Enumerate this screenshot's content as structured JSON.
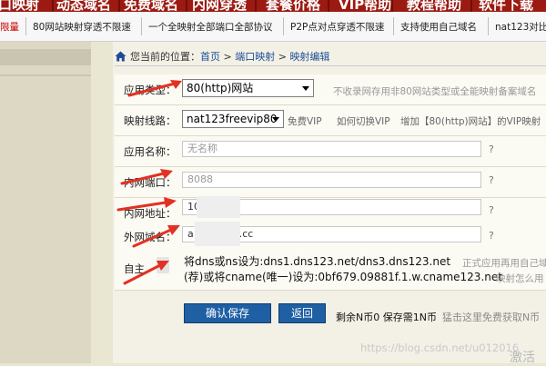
{
  "top_nav": {
    "items": [
      "口映射",
      "动态域名",
      "免费域名",
      "内网穿透",
      "套餐价格",
      "VIP帮助",
      "教程帮助",
      "软件下载"
    ]
  },
  "ticker": {
    "items": [
      "限量",
      "80网站映射穿透不限速",
      "一个全映射全部端口全部协议",
      "P2P点对点穿透不限速",
      "支持使用自己域名",
      "nat123对比"
    ]
  },
  "breadcrumb": {
    "prefix": "您当前的位置：",
    "home": "首页",
    "sep": ">",
    "section": "端口映射",
    "page": "映射编辑"
  },
  "form": {
    "app_type": {
      "label": "应用类型：",
      "value": "80(http)网站",
      "note": "不收录网存用非80网站类型或全能映射备案域名"
    },
    "line": {
      "label": "映射线路：",
      "value": "nat123freevip80",
      "vip": "免费VIP",
      "howto": "如何切换VIP",
      "add": "增加【80(http)网站】的VIP映射"
    },
    "app_name": {
      "label": "应用名称：",
      "placeholder": "无名称",
      "q": "?"
    },
    "inner_port": {
      "label": "内网端口：",
      "value": "8088",
      "q": "?"
    },
    "inner_addr": {
      "label": "内网地址：",
      "value": "10",
      "q": "?"
    },
    "outer_domain": {
      "label": "外网域名：",
      "value_pre": "a",
      "value_post": ".cc",
      "q": "?"
    },
    "custom": {
      "label": "自主",
      "dns_line": "将dns或ns设为:dns1.dns123.net/dns3.dns123.net",
      "cname_line": "(荐)或将cname(唯一)设为:0bf679.09881f.1.w.cname123.net",
      "right1": "正式应用再用自己域",
      "right2": "映射怎么用"
    }
  },
  "buttons": {
    "save": "确认保存",
    "back": "返回"
  },
  "balance": {
    "text": "剩余N币0 保存需1N币",
    "hint": "猛击这里免费获取N币",
    "q": "?"
  },
  "watermark": "https://blog.csdn.net/u012016",
  "activate": "激活"
}
